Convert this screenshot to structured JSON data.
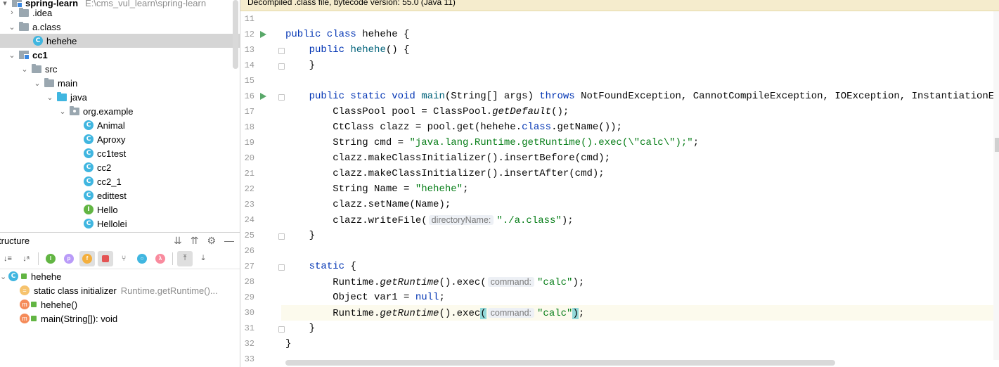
{
  "project": {
    "root_label": "spring-learn",
    "root_path": "E:\\cms_vul_learn\\spring-learn",
    "items": [
      {
        "label": "spring-learn",
        "chevron": "▾",
        "icon": "module",
        "depth": 0
      },
      {
        "label": ".idea",
        "chevron": "›",
        "icon": "folder",
        "depth": 1
      },
      {
        "label": "a.class",
        "chevron": "⌄",
        "icon": "folder",
        "depth": 1
      },
      {
        "label": "hehehe",
        "chevron": "",
        "icon": "class",
        "depth": 2
      },
      {
        "label": "cc1",
        "chevron": "⌄",
        "icon": "module",
        "depth": 0
      },
      {
        "label": "src",
        "chevron": "⌄",
        "icon": "folder",
        "depth": 1
      },
      {
        "label": "main",
        "chevron": "⌄",
        "icon": "folder",
        "depth": 2
      },
      {
        "label": "java",
        "chevron": "⌄",
        "icon": "folder-blue",
        "depth": 3
      },
      {
        "label": "org.example",
        "chevron": "⌄",
        "icon": "package",
        "depth": 4
      },
      {
        "label": "Animal",
        "chevron": "",
        "icon": "class",
        "depth": 5
      },
      {
        "label": "Aproxy",
        "chevron": "",
        "icon": "class",
        "depth": 5
      },
      {
        "label": "cc1test",
        "chevron": "",
        "icon": "class",
        "depth": 5
      },
      {
        "label": "cc2",
        "chevron": "",
        "icon": "class",
        "depth": 5
      },
      {
        "label": "cc2_1",
        "chevron": "",
        "icon": "class",
        "depth": 5
      },
      {
        "label": "edittest",
        "chevron": "",
        "icon": "class",
        "depth": 5
      },
      {
        "label": "Hello",
        "chevron": "",
        "icon": "interface",
        "depth": 5
      },
      {
        "label": "Hellolei",
        "chevron": "",
        "icon": "class",
        "depth": 5
      }
    ],
    "selected": "hehehe"
  },
  "structure": {
    "title": "tructure",
    "items": [
      {
        "label": "hehehe",
        "hint": ""
      },
      {
        "label": "static class initializer",
        "hint": "Runtime.getRuntime()..."
      },
      {
        "label": "hehehe()",
        "hint": ""
      },
      {
        "label": "main(String[]): void",
        "hint": ""
      }
    ]
  },
  "editor": {
    "banner": "Decompiled .class file, bytecode version: 55.0 (Java 11)",
    "line_numbers": [
      "11",
      "12",
      "13",
      "14",
      "15",
      "16",
      "17",
      "18",
      "19",
      "20",
      "21",
      "22",
      "23",
      "24",
      "25",
      "26",
      "27",
      "28",
      "29",
      "30",
      "31",
      "32",
      "33"
    ],
    "hints": {
      "directory": "directoryName:",
      "command": "command:"
    },
    "strings": {
      "cmd": "\"java.lang.Runtime.getRuntime().exec(\\\"calc\\\");\"",
      "name": "\"hehehe\"",
      "file": "\"./a.class\"",
      "calc": "\"calc\""
    }
  },
  "colors": {
    "keyword": "#0033b3",
    "string": "#067d17",
    "run_icon": "#59a869",
    "class_icon": "#40b6e0",
    "selected_row": "#d5d5d5",
    "banner": "#f5eccd"
  }
}
